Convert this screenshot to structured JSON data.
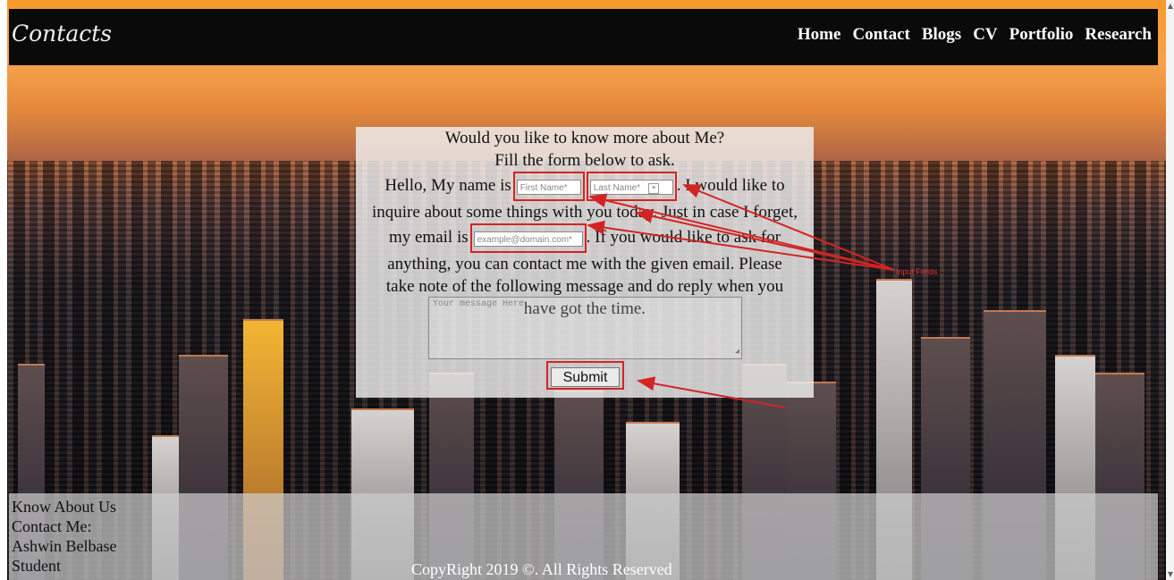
{
  "header": {
    "logo": "Contacts",
    "nav": [
      "Home",
      "Contact",
      "Blogs",
      "CV",
      "Portfolio",
      "Research"
    ]
  },
  "form": {
    "heading_line1": "Would you like to know more about Me?",
    "heading_line2": "Fill the form below to ask.",
    "text_before_name": "Hello, My name is",
    "first_name_placeholder": "First Name*",
    "last_name_placeholder": "Last Name*",
    "text_after_name_1": ". I would like to",
    "text_after_name_2": "inquire about some things with you today. Just in case I forget,",
    "text_before_email": "my email is",
    "email_placeholder": "example@domain.com*",
    "text_after_email": ". If you would like to ask for",
    "text_line5": "anything, you can contact me with the given email. Please",
    "text_line6": "take note of the following message and do reply when you",
    "text_line7": "have got the time.",
    "message_placeholder": "Your message Here",
    "submit_label": "Submit"
  },
  "annotation": {
    "label": "Input Fields",
    "color": "#d32424"
  },
  "footer": {
    "know_about": "Know About Us",
    "contact": "Contact Me:",
    "name": "Ashwin Belbase",
    "role": "Student",
    "copyright": "CopyRight 2019 ©. All Rights Reserved"
  }
}
